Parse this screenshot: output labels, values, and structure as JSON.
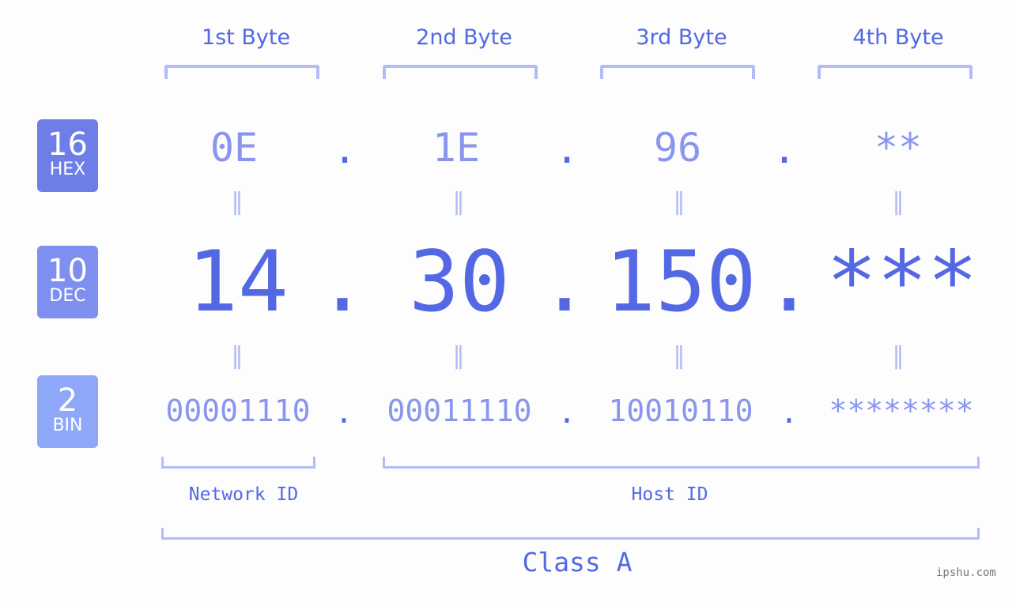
{
  "byte_headers": [
    "1st Byte",
    "2nd Byte",
    "3rd Byte",
    "4th Byte"
  ],
  "rows": {
    "hex": {
      "base": "16",
      "label": "HEX",
      "color": "#6e7ee8",
      "values": [
        "0E",
        "1E",
        "96",
        "**"
      ]
    },
    "dec": {
      "base": "10",
      "label": "DEC",
      "color": "#7f8ff0",
      "values": [
        "14",
        "30",
        "150",
        "***"
      ]
    },
    "bin": {
      "base": "2",
      "label": "BIN",
      "color": "#8fa7f9",
      "values": [
        "00001110",
        "00011110",
        "10010110",
        "********"
      ]
    }
  },
  "separator": ".",
  "equals": "=",
  "network_id_label": "Network ID",
  "host_id_label": "Host ID",
  "class_label": "Class A",
  "watermark": "ipshu.com",
  "colors": {
    "primary": "#5468e4",
    "light": "#8a95ee",
    "bracket": "#b3bcf6"
  }
}
